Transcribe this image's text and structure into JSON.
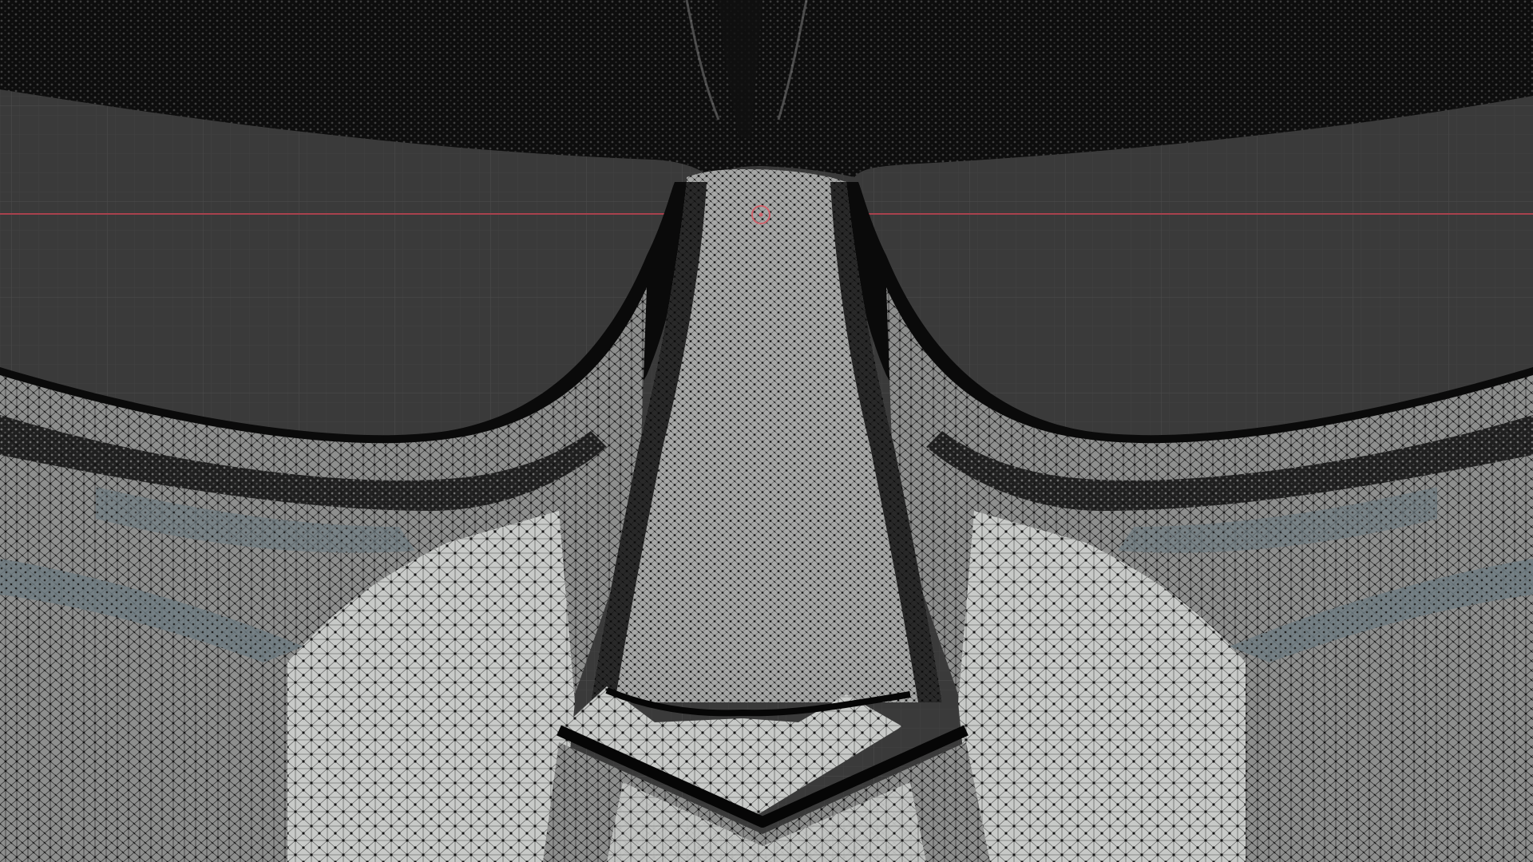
{
  "app": {
    "name": "",
    "mode": "edit-mode-wireframe"
  },
  "viewport": {
    "shading": "solid-with-wireframe-overlay",
    "grid_visible": true,
    "x_axis_line_visible": true,
    "object_origin_visible": true
  },
  "colors": {
    "background": "#3a3a3a",
    "grid_minor": "#414141",
    "grid_major": "#4a4a4a",
    "x_axis": "#a8414d",
    "mesh_dark": "#0b0b0b",
    "mesh_mid": "#2a2a2a",
    "mesh_light": "#c9cbc9",
    "mesh_blue_tint": "#7e8c92",
    "origin_ring": "#d0606a"
  },
  "icons": {
    "origin": "object-origin-icon"
  }
}
